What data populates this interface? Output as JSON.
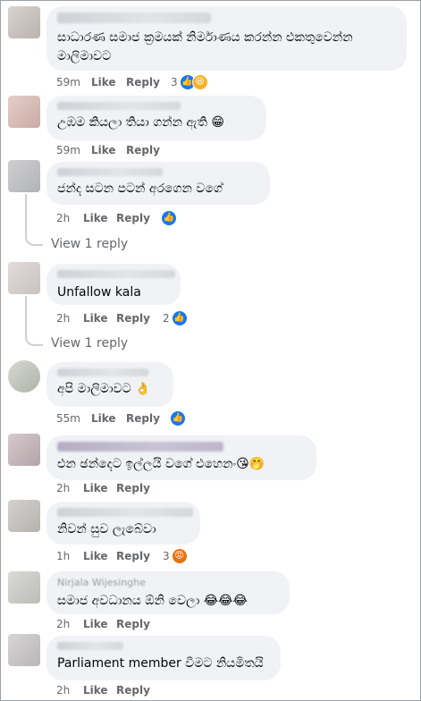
{
  "comments": [
    {
      "text": "සාධාරණ සමාජ ක්‍රමයක් නිර්මාණය කරන්න එකතුවෙන්න මාලිමාවට",
      "time": "59m",
      "like": "Like",
      "reply": "Reply",
      "reaction_count": "3",
      "reactions": [
        "like-icon",
        "haha-icon"
      ]
    },
    {
      "name_partial": "...",
      "text": "උඹම කියලා තියා ගන්න ඇති 😁",
      "time": "59m",
      "like": "Like",
      "reply": "Reply"
    },
    {
      "text": "ජන්ද සටන පටන් අරගෙන වගේ",
      "time": "2h",
      "like": "Like",
      "reply": "Reply",
      "reactions": [
        "like-icon"
      ],
      "view_replies": "View 1 reply"
    },
    {
      "text": "Unfallow kala",
      "time": "2h",
      "like": "Like",
      "reply": "Reply",
      "reaction_count": "2",
      "reactions": [
        "like-icon"
      ],
      "view_replies": "View 1 reply"
    },
    {
      "text": "අපි මාලිමාවට 👌",
      "time": "55m",
      "like": "Like",
      "reply": "Reply",
      "reactions": [
        "like-icon"
      ]
    },
    {
      "text": "එන ඡන්දෙට ඉල්ලයි වගේ එහෙනං😘🤭",
      "time": "2h",
      "like": "Like",
      "reply": "Reply"
    },
    {
      "text": "නිවන් සුව ලැබේවා",
      "time": "1h",
      "like": "Like",
      "reply": "Reply",
      "reaction_count": "3",
      "reactions": [
        "angry-icon"
      ]
    },
    {
      "name_partial": "Nirjala Wijesinghe",
      "text": "සමාජ අවධානය ඕනි වෙලා 😂😂😂",
      "time": "2h",
      "like": "Like",
      "reply": "Reply"
    },
    {
      "name_partial": "...",
      "text": "Parliament member වීමට නියමිතයි",
      "time": "2h",
      "like": "Like",
      "reply": "Reply"
    }
  ]
}
